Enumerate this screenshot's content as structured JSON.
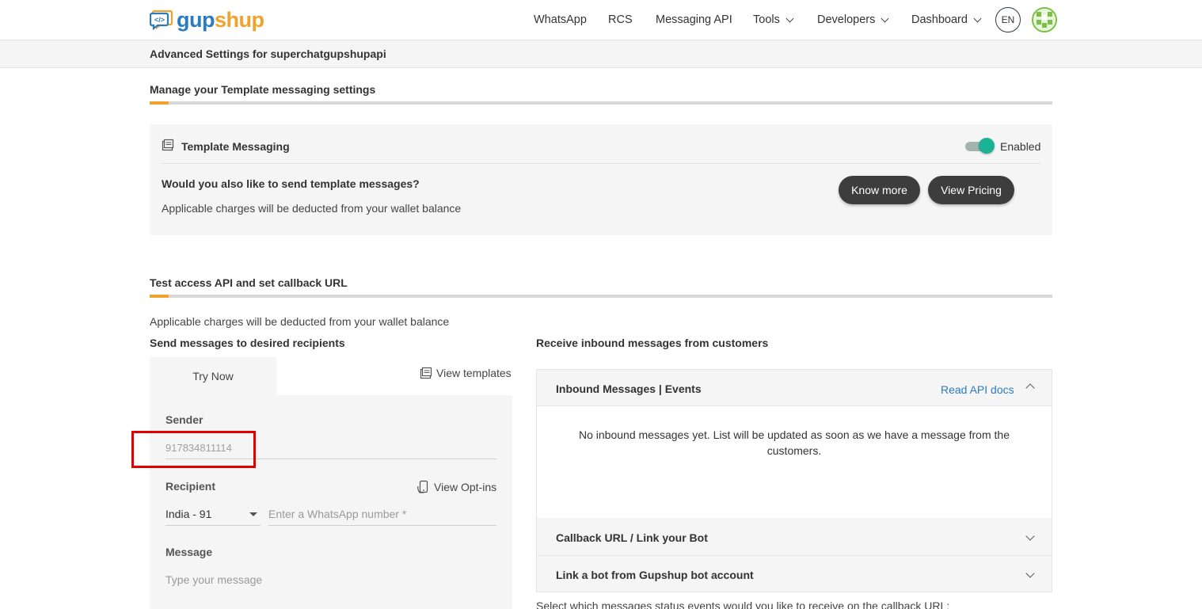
{
  "brand": {
    "part1": "gup",
    "part2": "shup"
  },
  "nav": {
    "items": [
      {
        "label": "WhatsApp",
        "dropdown": false
      },
      {
        "label": "RCS",
        "dropdown": false
      },
      {
        "label": "Messaging API",
        "dropdown": false
      },
      {
        "label": "Tools",
        "dropdown": true
      },
      {
        "label": "Developers",
        "dropdown": true
      },
      {
        "label": "Dashboard",
        "dropdown": true
      }
    ],
    "language": "EN"
  },
  "subheader": {
    "title": "Advanced Settings for superchatgupshupapi"
  },
  "template_section": {
    "title": "Manage your Template messaging settings",
    "card_title": "Template Messaging",
    "toggle_state": "Enabled",
    "toggle_on": true,
    "question": "Would you also like to send template messages?",
    "note": "Applicable charges will be deducted from your wallet balance",
    "know_more": "Know more",
    "view_pricing": "View Pricing"
  },
  "api_section": {
    "title": "Test access API and set callback URL",
    "note": "Applicable charges will be deducted from your wallet balance",
    "send_heading": "Send messages to desired recipients",
    "receive_heading": "Receive inbound messages from customers"
  },
  "send_form": {
    "tab_label": "Try Now",
    "view_templates": "View templates",
    "sender_label": "Sender",
    "sender_value": "917834811114",
    "recipient_label": "Recipient",
    "view_optins": "View Opt-ins",
    "country_selected": "India - 91",
    "number_placeholder": "Enter a WhatsApp number *",
    "message_label": "Message",
    "message_placeholder": "Type your message"
  },
  "inbound": {
    "panel1_title": "Inbound Messages | Events",
    "read_docs": "Read API docs",
    "empty_text": "No inbound messages yet. List will be updated as soon as we have a message from the customers.",
    "panel2_title": "Callback URL / Link your Bot",
    "panel3_title": "Link a bot from Gupshup bot account",
    "status_prompt": "Select which messages status events would you like to receive on the callback URL:"
  },
  "colors": {
    "brand_blue": "#2a7bbf",
    "brand_orange": "#f0a22c",
    "toggle_green": "#1ab394",
    "highlight_red": "#e00000",
    "pill_dark": "#3d3d3d"
  }
}
